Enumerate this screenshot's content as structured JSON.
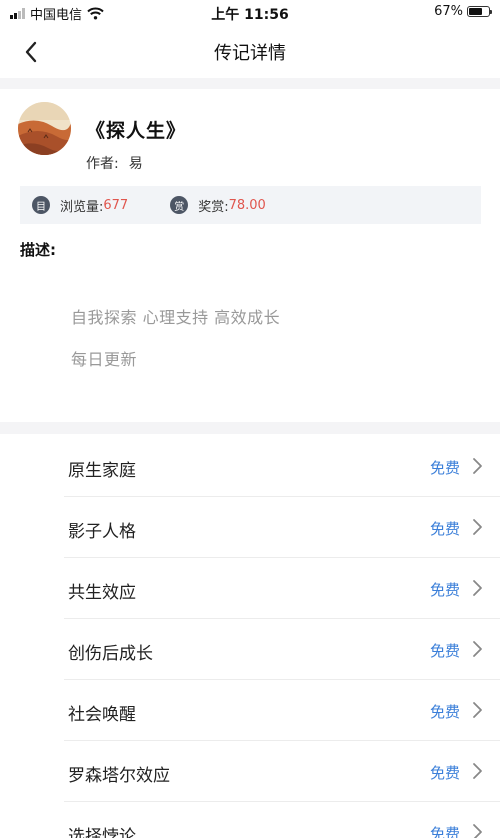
{
  "status_bar": {
    "carrier": "中国电信",
    "time": "上午 11:56",
    "battery_percent": "67%",
    "battery_level": 0.67,
    "icons": [
      "signal-icon",
      "wifi-icon",
      "battery-icon"
    ]
  },
  "nav": {
    "title": "传记详情",
    "back_icon": "chevron-left-icon"
  },
  "book": {
    "title": "《探人生》",
    "author_label": "作者:",
    "author_name": "易",
    "cover": "desert-landscape-image"
  },
  "stats": {
    "views_icon_char": "目",
    "views_label": "浏览量:",
    "views_value": "677",
    "reward_icon_char": "赏",
    "reward_label": "奖赏:",
    "reward_value": "78.00"
  },
  "description": {
    "label": "描述:",
    "lines": [
      "自我探索 心理支持 高效成长",
      "每日更新"
    ]
  },
  "chapters": [
    {
      "title": "原生家庭",
      "price": "免费"
    },
    {
      "title": "影子人格",
      "price": "免费"
    },
    {
      "title": "共生效应",
      "price": "免费"
    },
    {
      "title": "创伤后成长",
      "price": "免费"
    },
    {
      "title": "社会唤醒",
      "price": "免费"
    },
    {
      "title": "罗森塔尔效应",
      "price": "免费"
    },
    {
      "title": "选择悖论",
      "price": "免费"
    }
  ],
  "colors": {
    "accent_blue": "#3b7fd9",
    "value_red": "#e0564e",
    "band_gray": "#f4f4f6"
  }
}
